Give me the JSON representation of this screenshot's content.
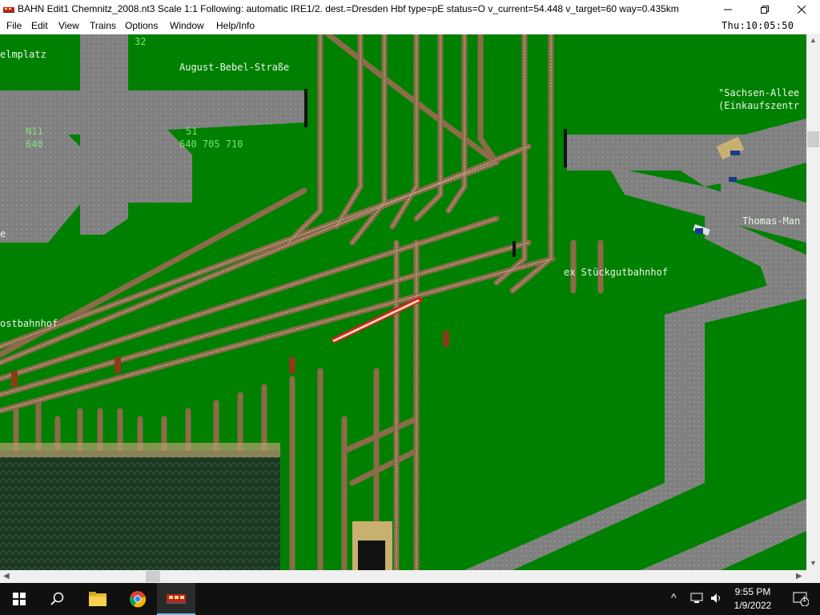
{
  "window": {
    "title": "BAHN Edit1 Chemnitz_2008.nt3 Scale 1:1 Following: automatic IRE1/2.  dest.=Dresden Hbf type=pE status=O  v_current=54.448 v_target=60 way=0.435km",
    "minimize_icon": "minimize-icon",
    "maximize_icon": "maximize-icon",
    "close_icon": "close-icon"
  },
  "menu": {
    "items": [
      "File",
      "Edit",
      "View",
      "Trains",
      "Options",
      "Window",
      "Help/Info"
    ],
    "clock": "Thu:10:05:50"
  },
  "map": {
    "labels": {
      "platz": "elmplatz",
      "august_bebel": "August-Bebel-Straße",
      "sachsen_allee": "\"Sachsen-Allee",
      "einkaufszentrum": "(Einkaufszentr",
      "thomas_mann": "Thomas-Man",
      "stueckgut": "ex Stückgutbahnhof",
      "ostbahnhof": "ostbahnhof",
      "e_label": "e"
    },
    "line_numbers": {
      "n32": "32",
      "n11": "N11",
      "n640": "640",
      "n51": "51",
      "n640_705_710": "640 705 710"
    },
    "colors": {
      "grass": "#008000",
      "road": "#808080",
      "track_bed": "#8b6b4a",
      "rail": "#c8b8a0",
      "train_red": "#d42020",
      "platform_dark": "#1c3a22"
    }
  },
  "taskbar": {
    "icons": [
      "windows-start-icon",
      "search-icon",
      "file-explorer-icon",
      "chrome-icon",
      "bahn-app-icon"
    ],
    "time": "9:55 PM",
    "date": "1/9/2022",
    "notification_count": "1"
  }
}
